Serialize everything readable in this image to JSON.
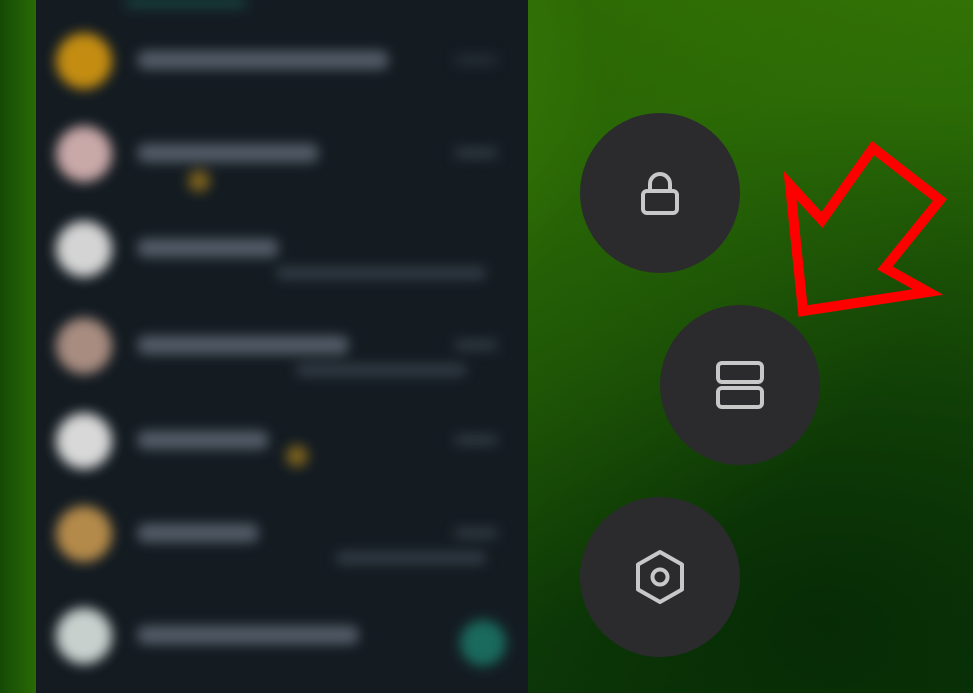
{
  "recents": {
    "avatar_colors": [
      "#c48d12",
      "#c9a8a8",
      "#d4d4d4",
      "#a88c80",
      "#d8d8d8",
      "#b48a4a",
      "#c8d0ce"
    ]
  },
  "quick_actions": [
    {
      "name": "lock-app",
      "icon": "lock-icon"
    },
    {
      "name": "split-screen",
      "icon": "split-screen-icon"
    },
    {
      "name": "app-settings",
      "icon": "settings-hexagon-icon"
    }
  ],
  "annotation": {
    "icon": "red-arrow-icon",
    "color": "#ff0000"
  },
  "colors": {
    "button_bg": "#2b2b2d",
    "icon_stroke": "#c8c8c8",
    "panel_bg": "#141c22"
  }
}
